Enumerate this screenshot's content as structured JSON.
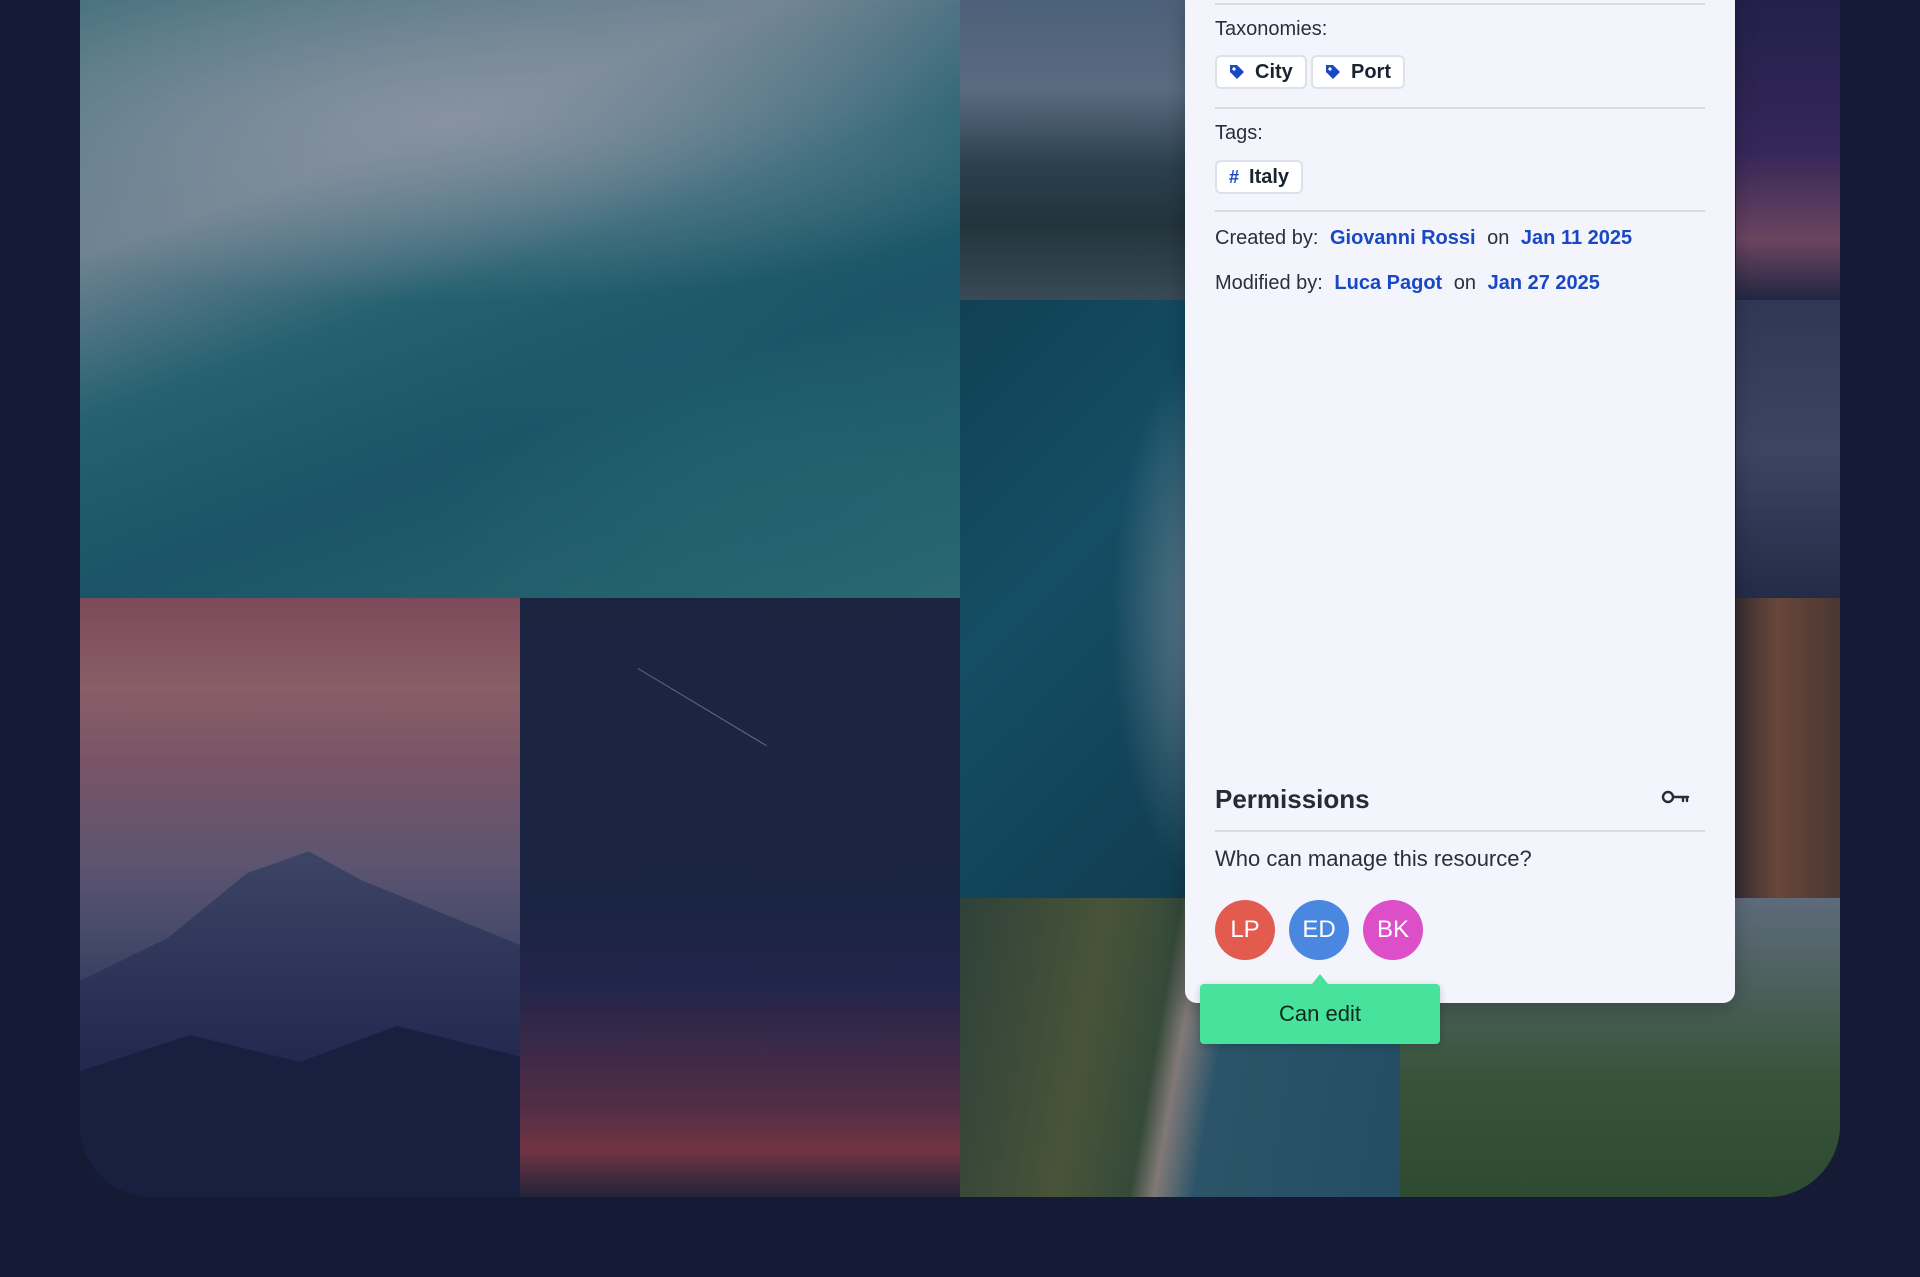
{
  "details": {
    "taxonomies_label": "Taxonomies:",
    "taxonomies": [
      {
        "label": "City",
        "icon": "tag-icon"
      },
      {
        "label": "Port",
        "icon": "tag-icon"
      }
    ],
    "tags_label": "Tags:",
    "tags": [
      {
        "label": "Italy",
        "icon": "hash-icon"
      }
    ],
    "created": {
      "label": "Created by:",
      "user": "Giovanni Rossi",
      "on": "on",
      "date": "Jan 11 2025"
    },
    "modified": {
      "label": "Modified by:",
      "user": "Luca Pagot",
      "on": "on",
      "date": "Jan 27 2025"
    }
  },
  "permissions": {
    "title": "Permissions",
    "icon": "key-icon",
    "question": "Who can manage this resource?",
    "avatars": [
      {
        "initials": "LP",
        "color": "#e35a4f"
      },
      {
        "initials": "ED",
        "color": "#4a87e0"
      },
      {
        "initials": "BK",
        "color": "#dc4fc9"
      }
    ],
    "tooltip": "Can edit"
  },
  "colors": {
    "accent": "#1849c4",
    "tooltip": "#47e29c",
    "background": "#161b35"
  }
}
